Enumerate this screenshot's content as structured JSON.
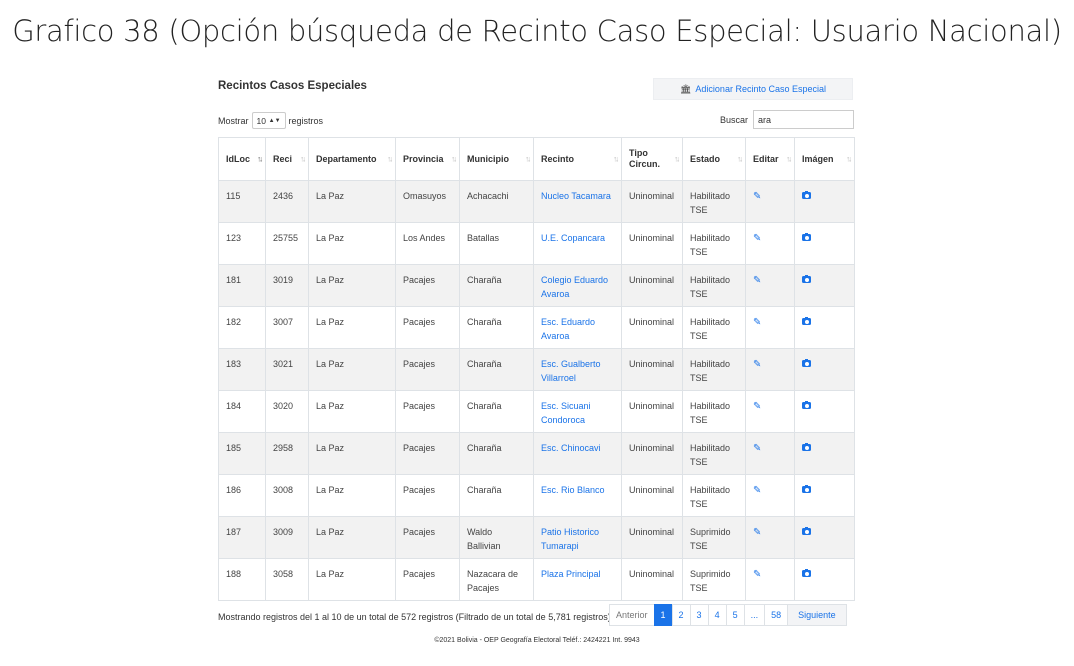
{
  "doc_title": "Grafico 38 (Opción búsqueda de Recinto Caso Especial: Usuario Nacional)",
  "panel": {
    "title": "Recintos Casos Especiales",
    "add_button": "Adicionar Recinto Caso Especial",
    "add_icon": "bank-icon"
  },
  "length": {
    "prefix": "Mostrar",
    "value": "10",
    "suffix": "registros"
  },
  "search": {
    "label": "Buscar",
    "value": "ara"
  },
  "columns": [
    "IdLoc",
    "Reci",
    "Departamento",
    "Provincia",
    "Municipio",
    "Recinto",
    "Tipo Circun.",
    "Estado",
    "Editar",
    "Imágen"
  ],
  "rows": [
    {
      "idloc": "115",
      "reci": "2436",
      "departamento": "La Paz",
      "provincia": "Omasuyos",
      "municipio": "Achacachi",
      "recinto": "Nucleo Tacamara",
      "tipo": "Uninominal",
      "estado": "Habilitado TSE"
    },
    {
      "idloc": "123",
      "reci": "25755",
      "departamento": "La Paz",
      "provincia": "Los Andes",
      "municipio": "Batallas",
      "recinto": "U.E. Copancara",
      "tipo": "Uninominal",
      "estado": "Habilitado TSE"
    },
    {
      "idloc": "181",
      "reci": "3019",
      "departamento": "La Paz",
      "provincia": "Pacajes",
      "municipio": "Charaña",
      "recinto": "Colegio Eduardo Avaroa",
      "tipo": "Uninominal",
      "estado": "Habilitado TSE"
    },
    {
      "idloc": "182",
      "reci": "3007",
      "departamento": "La Paz",
      "provincia": "Pacajes",
      "municipio": "Charaña",
      "recinto": "Esc. Eduardo Avaroa",
      "tipo": "Uninominal",
      "estado": "Habilitado TSE"
    },
    {
      "idloc": "183",
      "reci": "3021",
      "departamento": "La Paz",
      "provincia": "Pacajes",
      "municipio": "Charaña",
      "recinto": "Esc. Gualberto Villarroel",
      "tipo": "Uninominal",
      "estado": "Habilitado TSE"
    },
    {
      "idloc": "184",
      "reci": "3020",
      "departamento": "La Paz",
      "provincia": "Pacajes",
      "municipio": "Charaña",
      "recinto": "Esc. Sicuani Condoroca",
      "tipo": "Uninominal",
      "estado": "Habilitado TSE"
    },
    {
      "idloc": "185",
      "reci": "2958",
      "departamento": "La Paz",
      "provincia": "Pacajes",
      "municipio": "Charaña",
      "recinto": "Esc. Chinocavi",
      "tipo": "Uninominal",
      "estado": "Habilitado TSE"
    },
    {
      "idloc": "186",
      "reci": "3008",
      "departamento": "La Paz",
      "provincia": "Pacajes",
      "municipio": "Charaña",
      "recinto": "Esc. Rio Blanco",
      "tipo": "Uninominal",
      "estado": "Habilitado TSE"
    },
    {
      "idloc": "187",
      "reci": "3009",
      "departamento": "La Paz",
      "provincia": "Pacajes",
      "municipio": "Waldo Ballivian",
      "recinto": "Patio Historico Tumarapi",
      "tipo": "Uninominal",
      "estado": "Suprimido TSE"
    },
    {
      "idloc": "188",
      "reci": "3058",
      "departamento": "La Paz",
      "provincia": "Pacajes",
      "municipio": "Nazacara de Pacajes",
      "recinto": "Plaza Principal",
      "tipo": "Uninominal",
      "estado": "Suprimido TSE"
    }
  ],
  "row_icons": {
    "edit": "edit-icon",
    "image": "camera-icon"
  },
  "info": "Mostrando registros del 1 al 10 de un total de 572 registros (Filtrado de un total de 5,781 registros)",
  "pagination": {
    "previous": "Anterior",
    "pages": [
      "1",
      "2",
      "3",
      "4",
      "5",
      "...",
      "58"
    ],
    "active": "1",
    "next": "Siguiente"
  },
  "footer": "©2021 Bolivia - OEP Geografía Electoral Teléf.: 2424221 Int. 9943",
  "colors": {
    "link": "#1a73e8",
    "stripe": "#f2f2f2",
    "border": "#dee2e6"
  }
}
